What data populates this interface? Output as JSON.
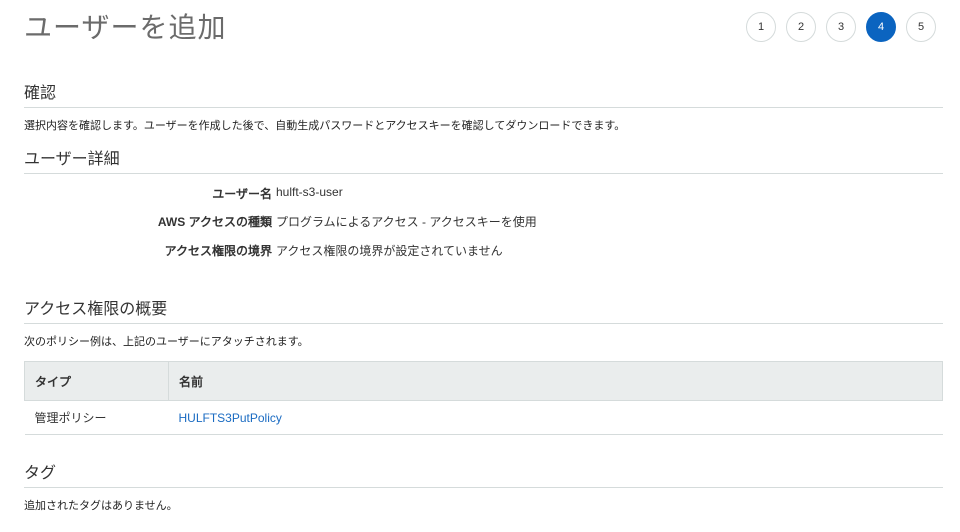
{
  "header": {
    "title": "ユーザーを追加",
    "steps": [
      "1",
      "2",
      "3",
      "4",
      "5"
    ],
    "active_step": 4
  },
  "review": {
    "heading": "確認",
    "description": "選択内容を確認します。ユーザーを作成した後で、自動生成パスワードとアクセスキーを確認してダウンロードできます。"
  },
  "user_details": {
    "heading": "ユーザー詳細",
    "rows": [
      {
        "label": "ユーザー名",
        "value": "hulft-s3-user"
      },
      {
        "label": "AWS アクセスの種類",
        "value": "プログラムによるアクセス - アクセスキーを使用"
      },
      {
        "label": "アクセス権限の境界",
        "value": "アクセス権限の境界が設定されていません"
      }
    ]
  },
  "permissions": {
    "heading": "アクセス権限の概要",
    "description": "次のポリシー例は、上記のユーザーにアタッチされます。",
    "columns": [
      "タイプ",
      "名前"
    ],
    "rows": [
      {
        "type": "管理ポリシー",
        "name": "HULFTS3PutPolicy"
      }
    ]
  },
  "tags": {
    "heading": "タグ",
    "description": "追加されたタグはありません。"
  },
  "colors": {
    "accent": "#0b64c0",
    "link": "#1a6bc2",
    "table_header_bg": "#eaeded",
    "divider": "#d5dbdb"
  }
}
